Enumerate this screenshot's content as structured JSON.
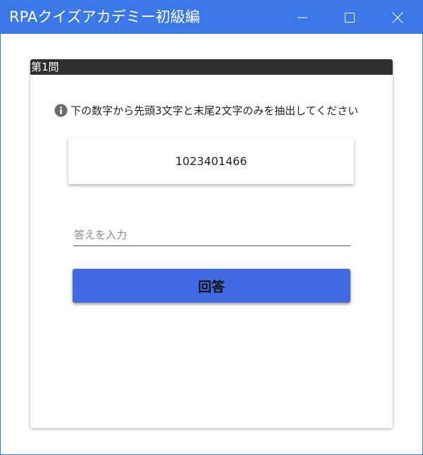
{
  "window": {
    "title": "RPAクイズアカデミー初級編",
    "controls": {
      "minimize_icon": "minimize-icon",
      "maximize_icon": "maximize-icon",
      "close_icon": "close-icon"
    },
    "titlebar_color": "#3b78e7"
  },
  "quiz": {
    "question_label": "第1問",
    "instruction": "下の数字から先頭3文字と末尾2文字のみを抽出してください",
    "info_icon": "info-icon",
    "number": "1023401466",
    "answer": {
      "value": "",
      "placeholder": "答えを入力"
    },
    "submit_label": "回答",
    "submit_color": "#4169e1",
    "header_color": "#2f2f2f"
  }
}
